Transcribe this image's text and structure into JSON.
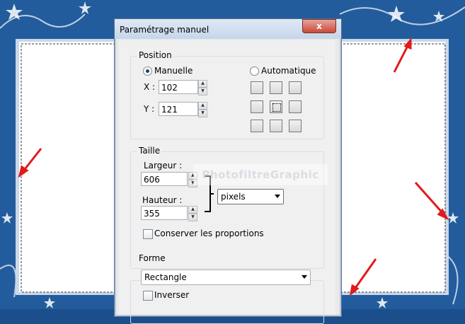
{
  "dialog": {
    "title": "Paramétrage manuel",
    "close_label": "x"
  },
  "position": {
    "legend": "Position",
    "manual_label": "Manuelle",
    "auto_label": "Automatique",
    "x_label": "X :",
    "x_value": "102",
    "y_label": "Y :",
    "y_value": "121",
    "selected_mode": "Manuelle"
  },
  "size": {
    "legend": "Taille",
    "width_label": "Largeur :",
    "width_value": "606",
    "height_label": "Hauteur :",
    "height_value": "355",
    "unit": "pixels",
    "keep_ratio_label": "Conserver les proportions"
  },
  "shape": {
    "legend": "Forme",
    "value": "Rectangle",
    "invert_label": "Inverser"
  },
  "watermark": "PhotofiltreGraphic",
  "colors": {
    "frame_blue": "#1a4f8c",
    "arrow_red": "#e01b1b"
  }
}
